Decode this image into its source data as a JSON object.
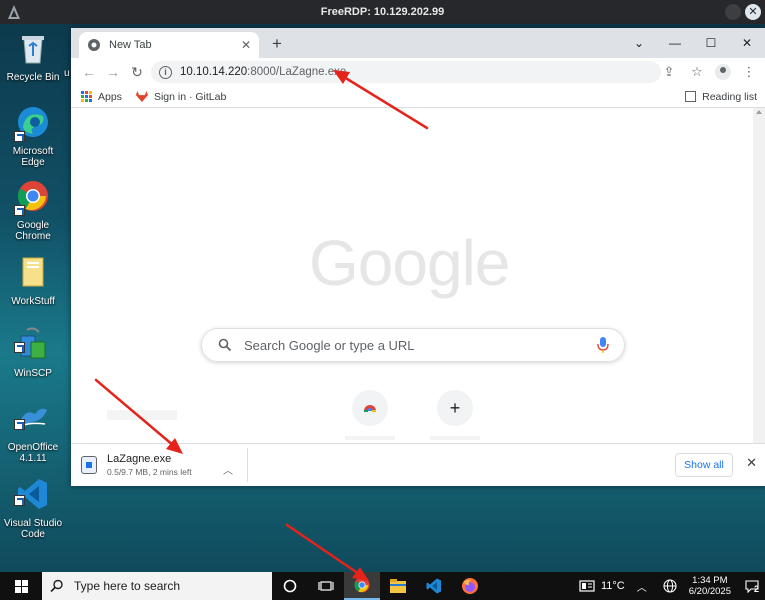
{
  "rdp": {
    "title": "FreeRDP: 10.129.202.99"
  },
  "desktop_icons": [
    {
      "label": "Recycle Bin",
      "icon": "recycle-bin-icon"
    },
    {
      "label": "Microsoft Edge",
      "icon": "edge-icon"
    },
    {
      "label": "Google Chrome",
      "icon": "chrome-icon"
    },
    {
      "label": "WorkStuff",
      "icon": "folder-icon"
    },
    {
      "label": "WinSCP",
      "icon": "winscp-icon"
    },
    {
      "label": "OpenOffice 4.1.11",
      "icon": "openoffice-icon"
    },
    {
      "label": "Visual Studio Code",
      "icon": "vscode-icon"
    }
  ],
  "desktop_partial_label": "u",
  "chrome": {
    "tab_title": "New Tab",
    "new_tab_glyph": "+",
    "url_host": "10.10.14.220",
    "url_path": ":8000/LaZagne.exe",
    "bookmarks": [
      {
        "label": "Apps",
        "icon": "apps-grid-icon"
      },
      {
        "label": "Sign in · GitLab",
        "icon": "gitlab-icon"
      }
    ],
    "reading_list": "Reading list",
    "logo_text": "Google",
    "search_placeholder": "Search Google or type a URL",
    "shortcut_add_glyph": "+"
  },
  "download": {
    "filename": "LaZagne.exe",
    "status": "0.5/9.7 MB, 2 mins left",
    "show_all": "Show all"
  },
  "taskbar": {
    "search_placeholder": "Type here to search",
    "temperature": "11°C",
    "time": "1:34 PM",
    "date": "6/20/2025",
    "notification_count": "2"
  },
  "colors": {
    "annotation_arrow": "#e5231b",
    "accent": "#1a73e8"
  }
}
